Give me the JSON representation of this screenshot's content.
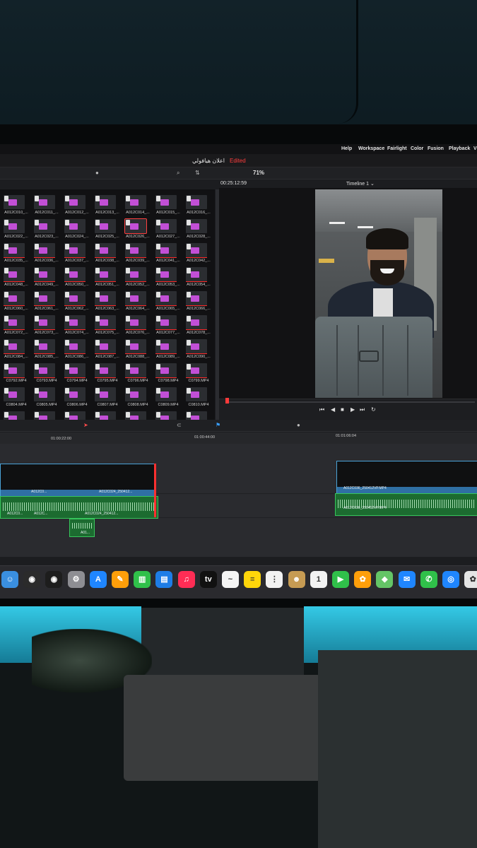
{
  "menu": {
    "items": [
      "Help",
      "Workspace",
      "Fairlight",
      "Color",
      "Fusion",
      "Playback",
      "V"
    ]
  },
  "window": {
    "project_title": "اعلان هيافولي",
    "status": "Edited"
  },
  "toolbar": {
    "zoom": "71%",
    "search_glyph": "⌕",
    "sort_glyph": "⇅"
  },
  "viewer": {
    "timecode": "00:25:12:59",
    "timeline_name": "Timeline 1 ⌄"
  },
  "media_pool": {
    "rows": [
      [
        "A012C010_...",
        "A012C011_...",
        "A012C012_...",
        "A012C013_...",
        "A012C014_...",
        "A012C015_...",
        "A012C016_..."
      ],
      [
        "A012C022_...",
        "A012C023_...",
        "A012C024_...",
        "A012C025_...",
        "A012C026_...",
        "A012C027_...",
        "A012C028_..."
      ],
      [
        "A012C035_...",
        "A012C036_...",
        "A012C037_...",
        "A012C038_...",
        "A012C039_...",
        "A012C041_...",
        "A012C042_..."
      ],
      [
        "A012C048_...",
        "A012C049_...",
        "A012C050_...",
        "A012C051_...",
        "A012C052_...",
        "A012C053_...",
        "A012C054_..."
      ],
      [
        "A012C060_...",
        "A012C061_...",
        "A012C062_...",
        "A012C063_...",
        "A012C064_...",
        "A012C065_...",
        "A012C066_..."
      ],
      [
        "A012C072_...",
        "A012C073_...",
        "A012C074_...",
        "A012C075_...",
        "A012C076_...",
        "A012C077_...",
        "A012C078_..."
      ],
      [
        "A012C084_...",
        "A012C085_...",
        "A012C086_...",
        "A012C087_...",
        "A012C088_...",
        "A012C089_...",
        "A012C090_..."
      ],
      [
        "C0792.MP4",
        "C0793.MP4",
        "C0794.MP4",
        "C0795.MP4",
        "C0796.MP4",
        "C0798.MP4",
        "C0799.MP4"
      ],
      [
        "C0804.MP4",
        "C0805.MP4",
        "C0806.MP4",
        "C0807.MP4",
        "C0808.MP4",
        "C0809.MP4",
        "C0810.MP4"
      ],
      [
        "",
        "",
        "",
        "",
        "",
        "",
        ""
      ]
    ]
  },
  "timeline": {
    "ruler": [
      "01:00:22:00",
      "01:00:44:00",
      "01:01:06:04"
    ],
    "video_clips": [
      {
        "label": "A012C024_250412..."
      },
      {
        "label": "A012C036_250412VP.MP4"
      }
    ],
    "audio_clips": [
      {
        "label": "A012C024_250412..."
      },
      {
        "label": "A012C036_250412VP.MP4"
      },
      {
        "label": "A01..."
      }
    ],
    "timeline_labels": [
      "A012C0...",
      "A012C0...",
      "A012C...",
      "A01..."
    ]
  },
  "transport": {
    "glyphs": [
      "⏮",
      "◀",
      "■",
      "▶",
      "⏭",
      "↻"
    ]
  },
  "dock": {
    "apps": [
      {
        "name": "Finder",
        "glyph": "☺",
        "color": "#3a8fe0"
      },
      {
        "name": "DaVinci Resolve",
        "glyph": "◉",
        "color": "#2b2b2b"
      },
      {
        "name": "DaVinci Resolve 2",
        "glyph": "◉",
        "color": "#1d1d1d"
      },
      {
        "name": "System Settings",
        "glyph": "⚙",
        "color": "#8e8e93"
      },
      {
        "name": "App Store",
        "glyph": "A",
        "color": "#1f86ff"
      },
      {
        "name": "Pages",
        "glyph": "✎",
        "color": "#ff9f0a"
      },
      {
        "name": "Numbers",
        "glyph": "▥",
        "color": "#30c04a"
      },
      {
        "name": "Keynote",
        "glyph": "▤",
        "color": "#1e7de6"
      },
      {
        "name": "Music",
        "glyph": "♫",
        "color": "#ff2d55"
      },
      {
        "name": "TV",
        "glyph": "tv",
        "color": "#111111"
      },
      {
        "name": "Freeform",
        "glyph": "~",
        "color": "#f5f5f5"
      },
      {
        "name": "Notes",
        "glyph": "≡",
        "color": "#ffd60a"
      },
      {
        "name": "Reminders",
        "glyph": "⋮",
        "color": "#f2f2f2"
      },
      {
        "name": "Contacts",
        "glyph": "☻",
        "color": "#c69b53"
      },
      {
        "name": "Calendar",
        "glyph": "1",
        "color": "#f2f2f2"
      },
      {
        "name": "FaceTime",
        "glyph": "▶",
        "color": "#30c04a"
      },
      {
        "name": "Photos",
        "glyph": "✿",
        "color": "#ff9f0a"
      },
      {
        "name": "Maps",
        "glyph": "◆",
        "color": "#64c466"
      },
      {
        "name": "Mail",
        "glyph": "✉",
        "color": "#1f86ff"
      },
      {
        "name": "Messages",
        "glyph": "✆",
        "color": "#30c04a"
      },
      {
        "name": "Safari",
        "glyph": "◎",
        "color": "#1f86ff"
      },
      {
        "name": "Photos 2",
        "glyph": "✿",
        "color": "#e5e5e5"
      }
    ]
  }
}
